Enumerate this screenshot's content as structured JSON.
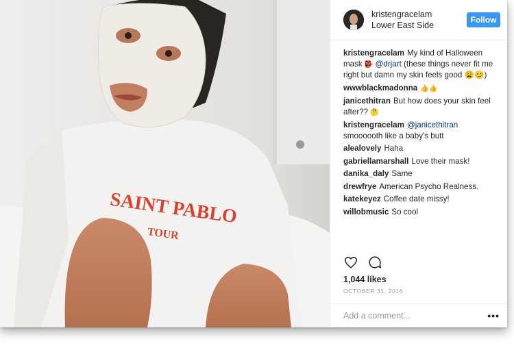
{
  "post": {
    "username": "kristengracelam",
    "location": "Lower East Side",
    "follow_label": "Follow",
    "photo_shirt_text": "SAINT PABLO",
    "photo_shirt_text2": "TOUR",
    "likes": "1,044 likes",
    "date": "OCTOBER 31, 2016",
    "comment_placeholder": "Add a comment...",
    "more_label": "•••"
  },
  "comments": [
    {
      "user": "kristengracelam",
      "pre": "My kind of Halloween mask ",
      "emoji": "👺",
      "mention": "@drjart",
      "post": " (these things never fit me right but damn my skin feels good 😩😊)"
    },
    {
      "user": "wwwblackmadonna",
      "pre": "",
      "emoji": "👍👍",
      "mention": "",
      "post": ""
    },
    {
      "user": "janicethitran",
      "pre": "But how does your skin feel after?? ",
      "emoji": "🤔",
      "mention": "",
      "post": ""
    },
    {
      "user": "kristengracelam",
      "pre": "",
      "emoji": "",
      "mention": "@janicethitran",
      "post": " smoooooth like a baby's butt"
    },
    {
      "user": "alealovely",
      "pre": "Haha",
      "emoji": "",
      "mention": "",
      "post": ""
    },
    {
      "user": "gabriellamarshall",
      "pre": "Love their mask!",
      "emoji": "",
      "mention": "",
      "post": ""
    },
    {
      "user": "danika_daly",
      "pre": "Same",
      "emoji": "",
      "mention": "",
      "post": ""
    },
    {
      "user": "drewfrye",
      "pre": "American Psycho Realness.",
      "emoji": "",
      "mention": "",
      "post": ""
    },
    {
      "user": "katekeyez",
      "pre": "Coffee date missy!",
      "emoji": "",
      "mention": "",
      "post": ""
    },
    {
      "user": "willobmusic",
      "pre": "So cool",
      "emoji": "",
      "mention": "",
      "post": ""
    }
  ],
  "icons": {
    "like": "heart-icon",
    "comment": "comment-bubble-icon",
    "more": "more-options-icon"
  },
  "colors": {
    "accent": "#3897f0",
    "mention": "#003569",
    "text": "#262626",
    "muted": "#999999"
  }
}
